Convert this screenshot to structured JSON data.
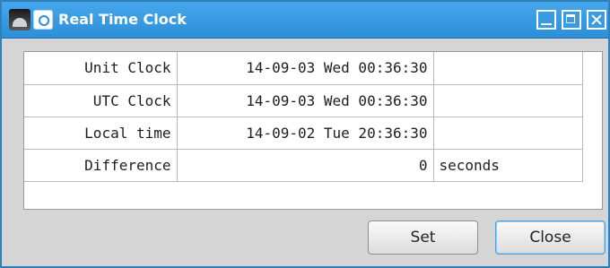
{
  "window": {
    "title": "Real Time Clock"
  },
  "rows": [
    {
      "label": "Unit Clock",
      "value": "14-09-03 Wed 00:36:30",
      "unit": ""
    },
    {
      "label": "UTC Clock",
      "value": "14-09-03 Wed 00:36:30",
      "unit": ""
    },
    {
      "label": "Local time",
      "value": "14-09-02 Tue 20:36:30",
      "unit": ""
    },
    {
      "label": "Difference",
      "value": "0",
      "unit": "seconds"
    }
  ],
  "buttons": {
    "set": "Set",
    "close": "Close"
  },
  "icons": {
    "app": "camera-app-icon",
    "system": "system-menu-icon",
    "minimize": "minimize-icon",
    "maximize": "maximize-icon",
    "close": "close-icon"
  }
}
